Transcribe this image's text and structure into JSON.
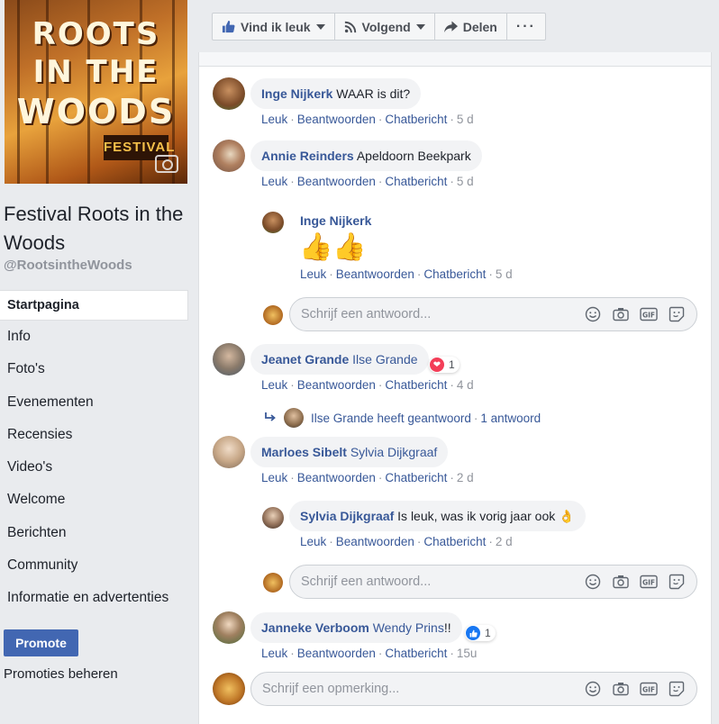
{
  "page": {
    "name": "Festival Roots in the Woods",
    "handle": "@RootsintheWoods",
    "cover_logo": [
      "ROOTS",
      "IN THE",
      "WOODS",
      "FESTIVAL"
    ]
  },
  "nav": {
    "items": [
      {
        "label": "Startpagina",
        "active": true
      },
      {
        "label": "Info"
      },
      {
        "label": "Foto's"
      },
      {
        "label": "Evenementen"
      },
      {
        "label": "Recensies"
      },
      {
        "label": "Video's"
      },
      {
        "label": "Welcome"
      },
      {
        "label": "Berichten"
      },
      {
        "label": "Community"
      },
      {
        "label": "Informatie en advertenties"
      }
    ],
    "promote_label": "Promote",
    "promotions_manage_label": "Promoties beheren"
  },
  "actionbar": {
    "like_label": "Vind ik leuk",
    "follow_label": "Volgend",
    "share_label": "Delen",
    "more_label": "···"
  },
  "actions": {
    "like": "Leuk",
    "reply": "Beantwoorden",
    "message": "Chatbericht",
    "dot": "·"
  },
  "comments": [
    {
      "author": "Inge Nijkerk",
      "text": "WAAR is dit?",
      "time": "5 d"
    },
    {
      "author": "Annie Reinders",
      "text": "Apeldoorn Beekpark",
      "time": "5 d",
      "replies": [
        {
          "author": "Inge Nijkerk",
          "text": "👍👍",
          "time": "5 d"
        }
      ],
      "reply_placeholder": "Schrijf een antwoord..."
    },
    {
      "author": "Jeanet Grande",
      "tag": "Ilse Grande",
      "time": "4 d",
      "reaction": {
        "type": "love",
        "count": "1"
      },
      "thread_summary": {
        "text": "Ilse Grande heeft geantwoord",
        "count": "1 antwoord"
      }
    },
    {
      "author": "Marloes Sibelt",
      "tag": "Sylvia Dijkgraaf",
      "time": "2 d",
      "replies": [
        {
          "author": "Sylvia Dijkgraaf",
          "text": "Is leuk, was ik vorig jaar ook 👌",
          "time": "2 d"
        }
      ],
      "reply_placeholder": "Schrijf een antwoord..."
    },
    {
      "author": "Janneke Verboom",
      "tag": "Wendy Prins",
      "text": "!!",
      "time": "15u",
      "reaction": {
        "type": "like",
        "count": "1"
      }
    }
  ],
  "comment_placeholder": "Schrijf een opmerking...",
  "colors": {
    "link": "#385898",
    "button": "#4267b2",
    "background": "#e9ebee",
    "bubble": "#f2f3f5",
    "muted": "#90949c",
    "love": "#f33e58"
  },
  "icons": {
    "like": "thumbs-up-icon",
    "follow": "rss-icon",
    "share": "share-arrow-icon",
    "emoji": "smiley-icon",
    "camera": "camera-icon",
    "gif": "gif-icon",
    "sticker": "sticker-icon"
  }
}
